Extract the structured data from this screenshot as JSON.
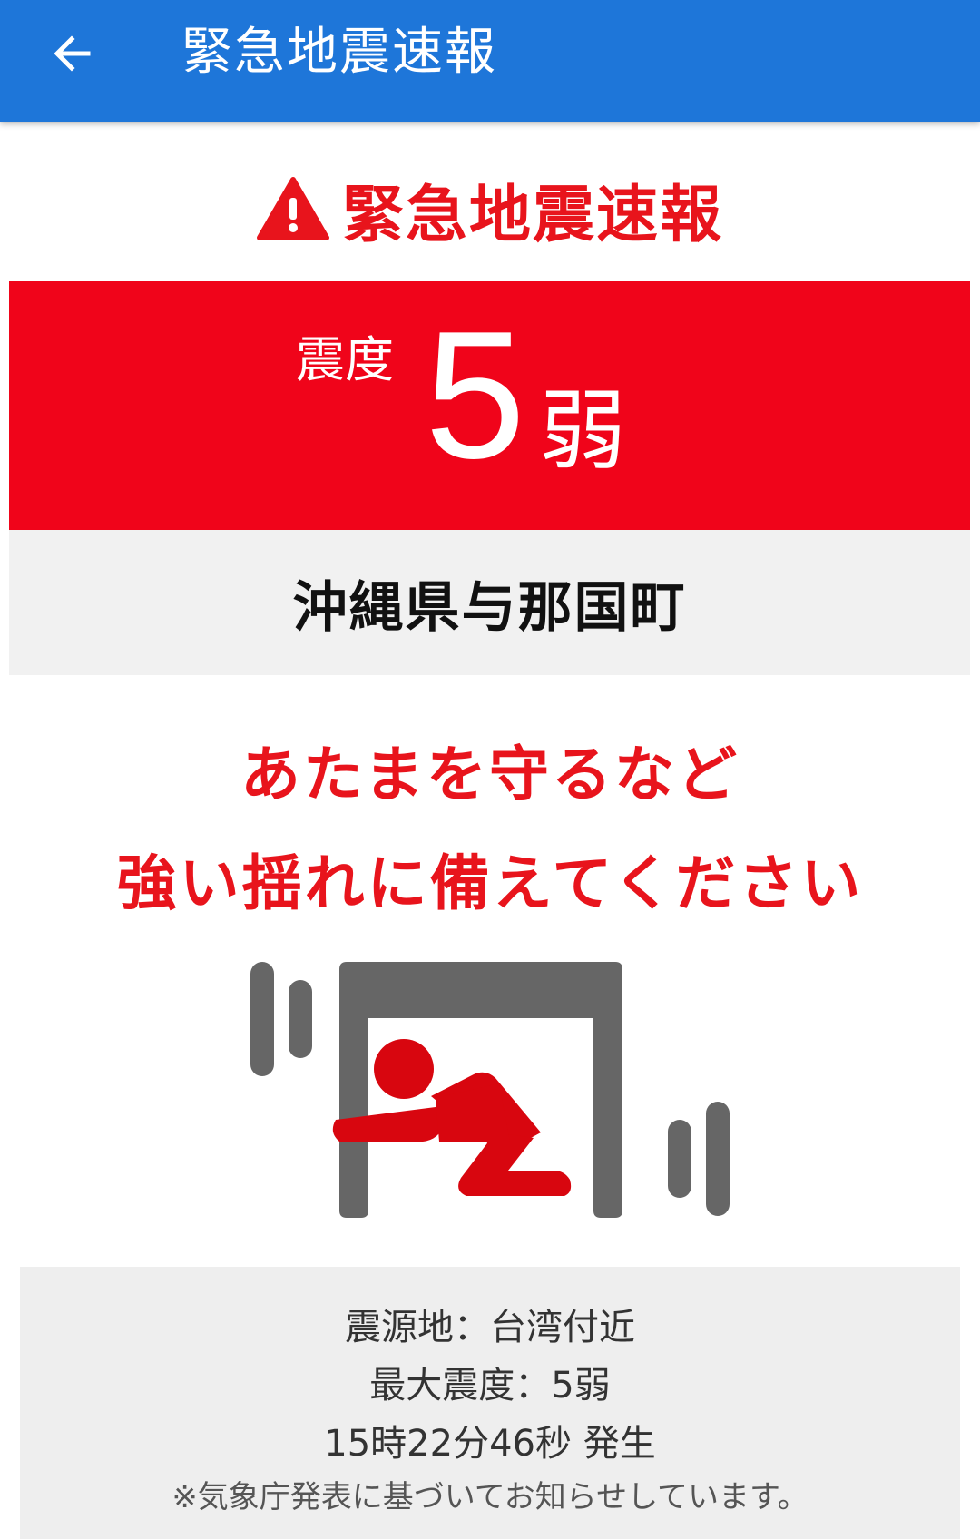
{
  "app_bar": {
    "title": "緊急地震速報",
    "back_icon": "arrow-left-icon",
    "background_color": "#1e76d9"
  },
  "alert": {
    "title": "緊急地震速報",
    "icon": "warning-triangle-icon",
    "accent_color": "#e8141c"
  },
  "intensity": {
    "label": "震度",
    "number": "5",
    "suffix": "弱",
    "background_color": "#f0041a"
  },
  "region": {
    "name": "沖縄県与那国町"
  },
  "warning": {
    "line1": "あたまを守るなど",
    "line2": "強い揺れに備えてください"
  },
  "illustration": {
    "icon": "person-under-table-icon"
  },
  "details": {
    "epicenter": "震源地：台湾付近",
    "max_intensity": "最大震度：5弱",
    "time": "15時22分46秒 発生",
    "note": "※気象庁発表に基づいてお知らせしています。"
  }
}
